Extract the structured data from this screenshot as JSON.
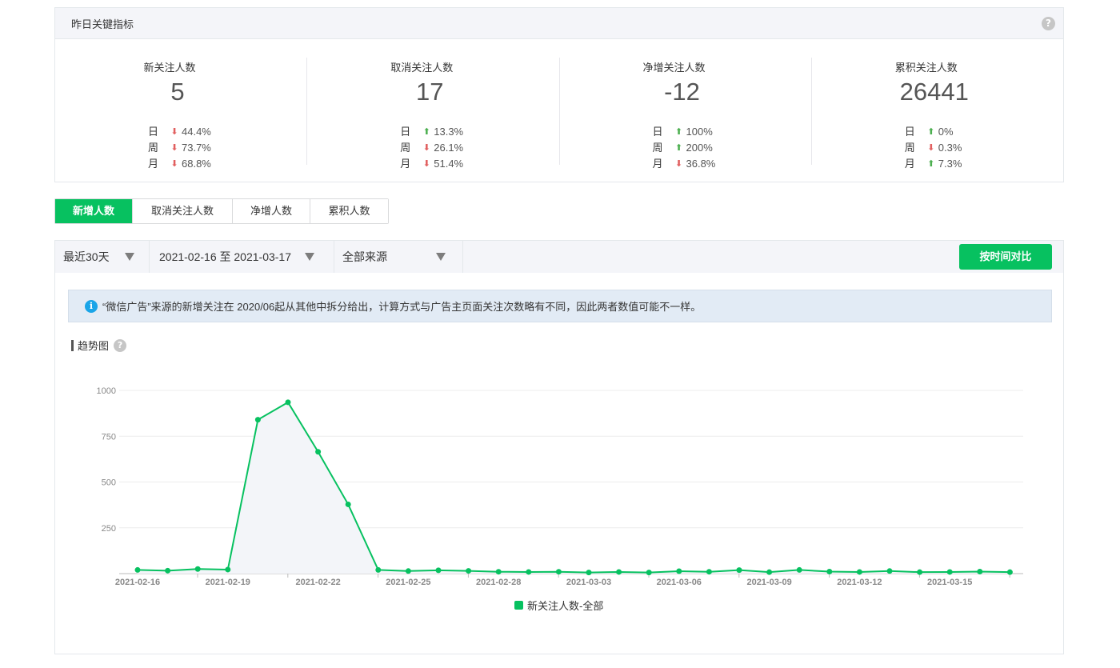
{
  "kpi_panel": {
    "title": "昨日关键指标",
    "help": "?",
    "metrics": [
      {
        "title": "新关注人数",
        "value": "5",
        "cmp": [
          {
            "label": "日",
            "dir": "down",
            "value": "44.4%"
          },
          {
            "label": "周",
            "dir": "down",
            "value": "73.7%"
          },
          {
            "label": "月",
            "dir": "down",
            "value": "68.8%"
          }
        ]
      },
      {
        "title": "取消关注人数",
        "value": "17",
        "cmp": [
          {
            "label": "日",
            "dir": "up",
            "value": "13.3%"
          },
          {
            "label": "周",
            "dir": "down",
            "value": "26.1%"
          },
          {
            "label": "月",
            "dir": "down",
            "value": "51.4%"
          }
        ]
      },
      {
        "title": "净增关注人数",
        "value": "-12",
        "cmp": [
          {
            "label": "日",
            "dir": "up",
            "value": "100%"
          },
          {
            "label": "周",
            "dir": "up",
            "value": "200%"
          },
          {
            "label": "月",
            "dir": "down",
            "value": "36.8%"
          }
        ]
      },
      {
        "title": "累积关注人数",
        "value": "26441",
        "cmp": [
          {
            "label": "日",
            "dir": "up",
            "value": "0%"
          },
          {
            "label": "周",
            "dir": "down",
            "value": "0.3%"
          },
          {
            "label": "月",
            "dir": "up",
            "value": "7.3%"
          }
        ]
      }
    ]
  },
  "tabs": [
    {
      "label": "新增人数",
      "active": true
    },
    {
      "label": "取消关注人数",
      "active": false
    },
    {
      "label": "净增人数",
      "active": false
    },
    {
      "label": "累积人数",
      "active": false
    }
  ],
  "filters": {
    "range": "最近30天",
    "dates": "2021-02-16 至 2021-03-17",
    "source": "全部来源",
    "compare_button": "按时间对比"
  },
  "notice": {
    "icon": "i",
    "text": "“微信广告”来源的新增关注在 2020/06起从其他中拆分给出，计算方式与广告主页面关注次数略有不同，因此两者数值可能不一样。"
  },
  "trend": {
    "title": "趋势图",
    "help": "?"
  },
  "colors": {
    "accent": "#07c160",
    "down": "#e15f5f",
    "up": "#4caf50",
    "notice_bg": "#e2ebf5"
  },
  "chart_data": {
    "type": "line",
    "x": [
      "2021-02-16",
      "2021-02-17",
      "2021-02-18",
      "2021-02-19",
      "2021-02-20",
      "2021-02-21",
      "2021-02-22",
      "2021-02-23",
      "2021-02-24",
      "2021-02-25",
      "2021-02-26",
      "2021-02-27",
      "2021-02-28",
      "2021-03-01",
      "2021-03-02",
      "2021-03-03",
      "2021-03-04",
      "2021-03-05",
      "2021-03-06",
      "2021-03-07",
      "2021-03-08",
      "2021-03-09",
      "2021-03-10",
      "2021-03-11",
      "2021-03-12",
      "2021-03-13",
      "2021-03-14",
      "2021-03-15",
      "2021-03-16",
      "2021-03-17"
    ],
    "x_tick_labels": [
      "2021-02-16",
      "2021-02-19",
      "2021-02-22",
      "2021-02-25",
      "2021-02-28",
      "2021-03-03",
      "2021-03-06",
      "2021-03-09",
      "2021-03-12",
      "2021-03-15"
    ],
    "series": [
      {
        "name": "新关注人数-全部",
        "values": [
          20,
          16,
          25,
          22,
          840,
          935,
          665,
          378,
          20,
          14,
          18,
          15,
          10,
          9,
          10,
          6,
          9,
          6,
          13,
          10,
          19,
          8,
          20,
          11,
          9,
          14,
          8,
          9,
          11,
          8
        ]
      }
    ],
    "y_ticks": [
      250,
      500,
      750,
      1000
    ],
    "ylim": [
      0,
      1000
    ],
    "grid": true,
    "legend": "bottom-center"
  }
}
